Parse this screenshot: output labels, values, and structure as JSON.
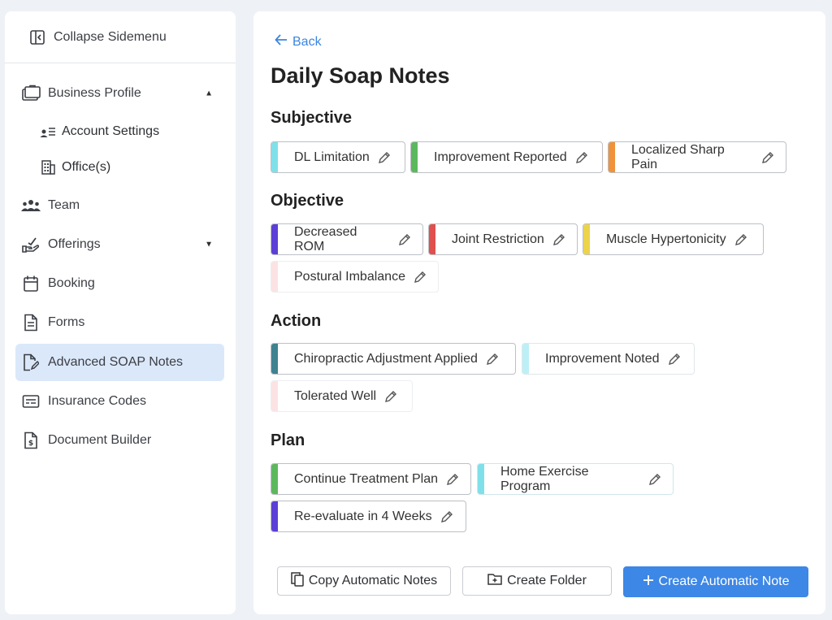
{
  "sidebar": {
    "collapse_label": "Collapse Sidemenu",
    "items": {
      "business_profile": "Business Profile",
      "account_settings": "Account Settings",
      "offices": "Office(s)",
      "team": "Team",
      "offerings": "Offerings",
      "booking": "Booking",
      "forms": "Forms",
      "advanced_soap_notes": "Advanced SOAP Notes",
      "insurance_codes": "Insurance Codes",
      "document_builder": "Document Builder"
    },
    "active_item": "Advanced SOAP Notes"
  },
  "main": {
    "back_label": "Back",
    "title": "Daily Soap Notes",
    "sections": {
      "subjective": {
        "heading": "Subjective",
        "chips": [
          {
            "label": "DL Limitation",
            "color": "#7fe0ea"
          },
          {
            "label": "Improvement Reported",
            "color": "#5cb85c"
          },
          {
            "label": "Localized Sharp Pain",
            "color": "#f0923a"
          }
        ]
      },
      "objective": {
        "heading": "Objective",
        "chips": [
          {
            "label": "Decreased ROM",
            "color": "#5b3fd6"
          },
          {
            "label": "Joint Restriction",
            "color": "#e0504d"
          },
          {
            "label": "Muscle Hypertonicity",
            "color": "#ecd34a"
          },
          {
            "label": "Postural Imbalance",
            "color": "#fbe3e3"
          }
        ]
      },
      "action": {
        "heading": "Action",
        "chips": [
          {
            "label": "Chiropractic Adjustment Applied",
            "color": "#3f8290"
          },
          {
            "label": "Improvement Noted",
            "color": "#bdf0f6"
          },
          {
            "label": "Tolerated Well",
            "color": "#fbe3e3"
          }
        ]
      },
      "plan": {
        "heading": "Plan",
        "chips": [
          {
            "label": "Continue Treatment Plan",
            "color": "#5cb85c"
          },
          {
            "label": "Home Exercise Program",
            "color": "#7fe0ea"
          },
          {
            "label": "Re-evaluate in 4 Weeks",
            "color": "#5b3fd6"
          }
        ]
      }
    },
    "buttons": {
      "copy": "Copy Automatic Notes",
      "create_folder": "Create Folder",
      "create_note": "Create Automatic Note"
    },
    "accent_color": "#3d87e6"
  }
}
